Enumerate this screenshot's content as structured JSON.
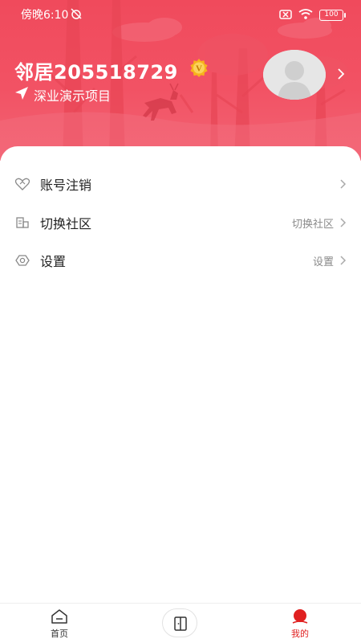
{
  "status_bar": {
    "time": "傍晚6:10",
    "battery": "100"
  },
  "profile": {
    "name": "邻居205518729",
    "vip_badge_letter": "V",
    "location": "深业演示项目"
  },
  "menu": [
    {
      "label": "账号注销",
      "value": "",
      "icon": "heart-handshake-icon"
    },
    {
      "label": "切换社区",
      "value": "切换社区",
      "icon": "building-icon"
    },
    {
      "label": "设置",
      "value": "设置",
      "icon": "settings-icon"
    }
  ],
  "tab_bar": {
    "home_label": "首页",
    "mine_label": "我的"
  },
  "colors": {
    "header": "#f04a5c",
    "active_tab": "#e02020"
  }
}
